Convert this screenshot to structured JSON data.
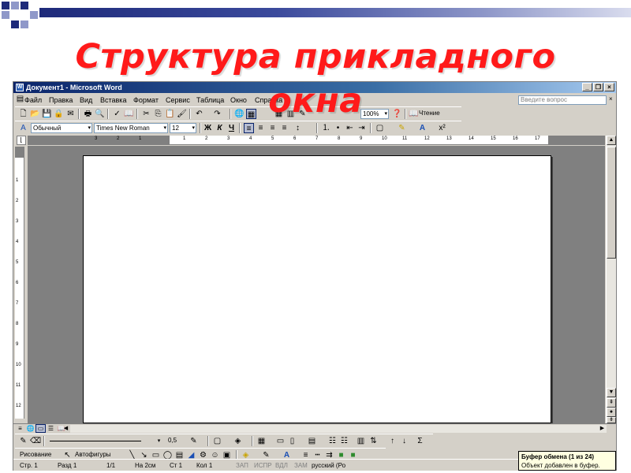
{
  "slide": {
    "title_line1": "Структура прикладного",
    "title_line2": "окна"
  },
  "window": {
    "title": "Документ1 - Microsoft Word",
    "controls": [
      "_",
      "❐",
      "×"
    ]
  },
  "menu": {
    "items": [
      "Файл",
      "Правка",
      "Вид",
      "Вставка",
      "Формат",
      "Сервис",
      "Таблица",
      "Окно",
      "Справка"
    ],
    "ask_placeholder": "Введите вопрос",
    "ask_close": "×"
  },
  "standard_toolbar": {
    "zoom": "100%",
    "reading": "Чтение"
  },
  "format_toolbar": {
    "style": "Обычный",
    "font": "Times New Roman",
    "size": "12",
    "bold": "Ж",
    "italic": "К",
    "underline": "Ч"
  },
  "ruler": {
    "h_labels": [
      "3",
      "2",
      "1",
      "1",
      "2",
      "3",
      "4",
      "5",
      "6",
      "7",
      "8",
      "9",
      "10",
      "11",
      "12",
      "13",
      "14",
      "15",
      "16",
      "17"
    ],
    "v_labels": [
      "1",
      "2",
      "3",
      "4",
      "5",
      "6",
      "7",
      "8",
      "9",
      "10",
      "11",
      "12"
    ]
  },
  "drawing_toolbar": {
    "line_width": "0,5",
    "draw": "Рисование",
    "autoshapes": "Автофигуры"
  },
  "status": {
    "page": "Стр. 1",
    "section": "Разд 1",
    "pages": "1/1",
    "at": "На 2см",
    "line": "Ст 1",
    "col": "Кол 1",
    "rec": "ЗАП",
    "trk": "ИСПР",
    "ext": "ВДЛ",
    "ovr": "ЗАМ",
    "lang": "русский (Ро"
  },
  "clipboard": {
    "title": "Буфер обмена (1 из 24)",
    "message": "Объект добавлен в буфер."
  },
  "colors": {
    "title": "#ff1a1a",
    "band": "#1e2a7a",
    "titlebar": "#0a246a",
    "chrome": "#d4d0c8"
  }
}
